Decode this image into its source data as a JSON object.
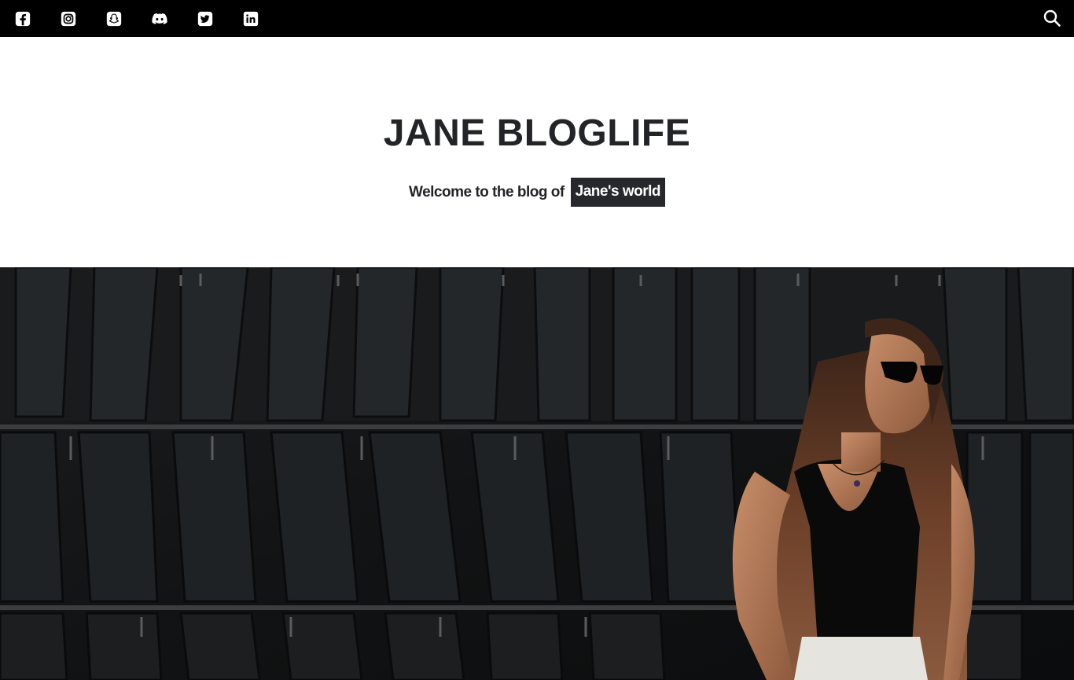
{
  "topbar": {
    "social_icons": [
      {
        "name": "facebook-icon"
      },
      {
        "name": "instagram-icon"
      },
      {
        "name": "snapchat-icon"
      },
      {
        "name": "discord-icon"
      },
      {
        "name": "twitter-icon"
      },
      {
        "name": "linkedin-icon"
      }
    ],
    "search_icon": "search-icon",
    "background": "#000000",
    "icon_color": "#ffffff"
  },
  "header": {
    "title": "JANE BLOGLIFE",
    "tagline_prefix": "Welcome to the blog of",
    "tagline_highlight": "Jane's world",
    "text_color": "#222428",
    "highlight_bg": "#26282c"
  },
  "hero": {
    "image": "woman-in-sunglasses-photo"
  }
}
